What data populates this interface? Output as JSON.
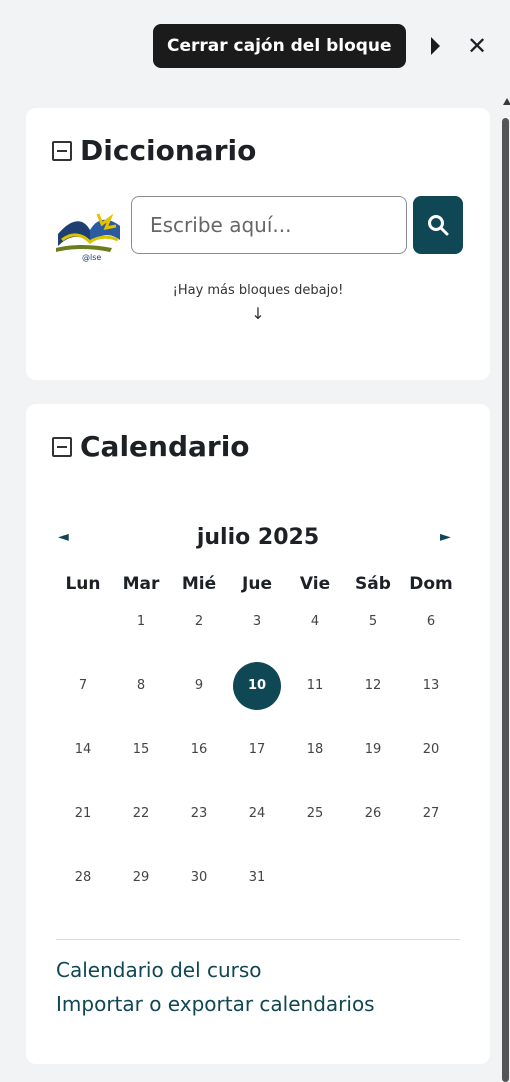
{
  "drawer": {
    "tooltip": "Cerrar cajón del bloque",
    "close_symbol": "✕"
  },
  "dictionary": {
    "title": "Diccionario",
    "logo_text": "@lse",
    "placeholder": "Escribe aquí...",
    "more_blocks": "¡Hay más bloques debajo!",
    "arrow": "↓"
  },
  "calendar": {
    "title": "Calendario",
    "prev": "◄",
    "next": "►",
    "month": "julio 2025",
    "weekdays": [
      "Lun",
      "Mar",
      "Mié",
      "Jue",
      "Vie",
      "Sáb",
      "Dom"
    ],
    "weeks": [
      [
        "",
        "1",
        "2",
        "3",
        "4",
        "5",
        "6"
      ],
      [
        "7",
        "8",
        "9",
        "10",
        "11",
        "12",
        "13"
      ],
      [
        "14",
        "15",
        "16",
        "17",
        "18",
        "19",
        "20"
      ],
      [
        "21",
        "22",
        "23",
        "24",
        "25",
        "26",
        "27"
      ],
      [
        "28",
        "29",
        "30",
        "31",
        "",
        "",
        ""
      ]
    ],
    "today": "10",
    "links": {
      "course": "Calendario del curso",
      "import_export": "Importar o exportar calendarios"
    }
  },
  "colors": {
    "accent": "#0f4754",
    "background": "#f2f3f5",
    "card": "#ffffff"
  }
}
